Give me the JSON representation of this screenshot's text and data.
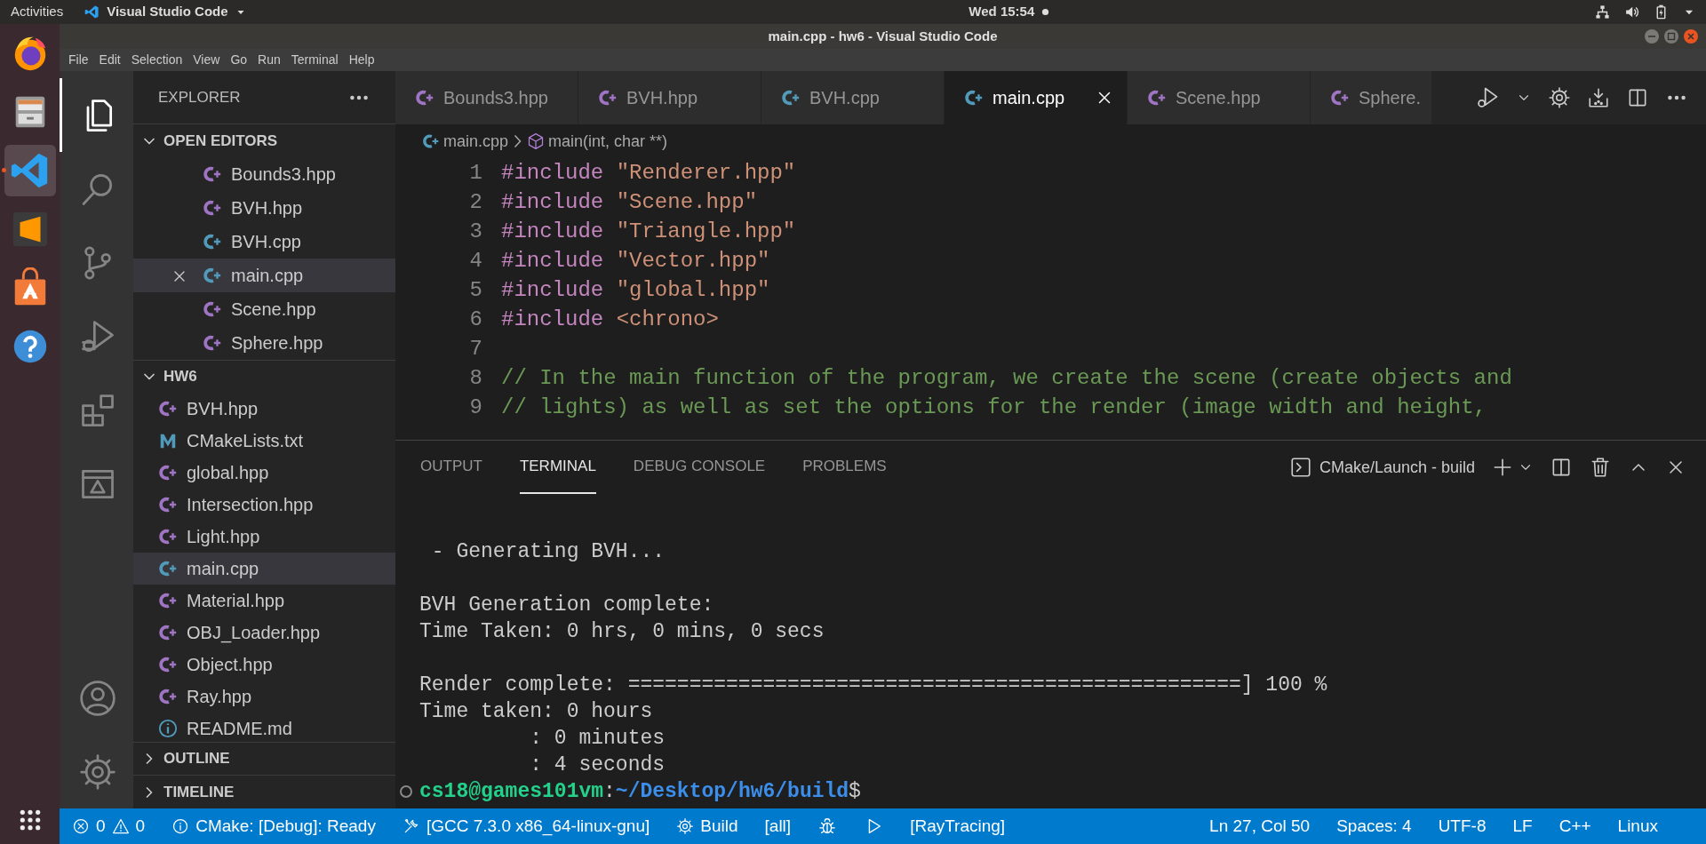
{
  "top_bar": {
    "activities": "Activities",
    "app_name": "Visual Studio Code",
    "clock": "Wed 15:54"
  },
  "window": {
    "title": "main.cpp - hw6 - Visual Studio Code"
  },
  "menu": [
    "File",
    "Edit",
    "Selection",
    "View",
    "Go",
    "Run",
    "Terminal",
    "Help"
  ],
  "dock": [
    {
      "kind": "browser",
      "selected": false
    },
    {
      "kind": "files",
      "selected": false
    },
    {
      "kind": "vscode",
      "selected": true
    },
    {
      "kind": "sublime",
      "selected": false
    },
    {
      "kind": "store",
      "selected": false
    },
    {
      "kind": "help",
      "selected": false
    }
  ],
  "activity_bar": [
    {
      "kind": "explorer",
      "selected": true
    },
    {
      "kind": "search",
      "selected": false
    },
    {
      "kind": "scm",
      "selected": false
    },
    {
      "kind": "debug",
      "selected": false
    },
    {
      "kind": "extensions",
      "selected": false
    },
    {
      "kind": "remote",
      "selected": false
    }
  ],
  "sidebar": {
    "title": "EXPLORER",
    "sections": [
      {
        "title": "OPEN EDITORS",
        "expanded": true,
        "items": [
          {
            "name": "Bounds3.hpp",
            "kind": "hpp",
            "selected": false
          },
          {
            "name": "BVH.hpp",
            "kind": "hpp",
            "selected": false
          },
          {
            "name": "BVH.cpp",
            "kind": "cpp",
            "selected": false
          },
          {
            "name": "main.cpp",
            "kind": "cpp",
            "selected": true
          },
          {
            "name": "Scene.hpp",
            "kind": "hpp",
            "selected": false
          },
          {
            "name": "Sphere.hpp",
            "kind": "hpp",
            "selected": false
          }
        ]
      },
      {
        "title": "HW6",
        "expanded": true,
        "items": [
          {
            "name": "BVH.hpp",
            "kind": "hpp",
            "selected": false
          },
          {
            "name": "CMakeLists.txt",
            "kind": "cmake",
            "selected": false
          },
          {
            "name": "global.hpp",
            "kind": "hpp",
            "selected": false
          },
          {
            "name": "Intersection.hpp",
            "kind": "hpp",
            "selected": false
          },
          {
            "name": "Light.hpp",
            "kind": "hpp",
            "selected": false
          },
          {
            "name": "main.cpp",
            "kind": "cpp",
            "selected": true
          },
          {
            "name": "Material.hpp",
            "kind": "hpp",
            "selected": false
          },
          {
            "name": "OBJ_Loader.hpp",
            "kind": "hpp",
            "selected": false
          },
          {
            "name": "Object.hpp",
            "kind": "hpp",
            "selected": false
          },
          {
            "name": "Ray.hpp",
            "kind": "hpp",
            "selected": false
          },
          {
            "name": "README.md",
            "kind": "info",
            "selected": false
          }
        ]
      },
      {
        "title": "OUTLINE",
        "expanded": false
      },
      {
        "title": "TIMELINE",
        "expanded": false
      }
    ]
  },
  "tabs": [
    {
      "label": "Bounds3.hpp",
      "kind": "hpp",
      "selected": false
    },
    {
      "label": "BVH.hpp",
      "kind": "hpp",
      "selected": false
    },
    {
      "label": "BVH.cpp",
      "kind": "cpp",
      "selected": false
    },
    {
      "label": "main.cpp",
      "kind": "cpp",
      "selected": true
    },
    {
      "label": "Scene.hpp",
      "kind": "hpp",
      "selected": false
    },
    {
      "label": "Sphere.",
      "kind": "hpp",
      "selected": false
    }
  ],
  "breadcrumb": [
    {
      "text": "main.cpp",
      "kind": "cpp"
    },
    {
      "text": "main(int, char **)",
      "kind": "symbol"
    }
  ],
  "code": [
    {
      "number": "1",
      "segments": [
        {
          "kind": "directive",
          "text": "#include "
        },
        {
          "kind": "string",
          "text": "\"Renderer.hpp\""
        }
      ]
    },
    {
      "number": "2",
      "segments": [
        {
          "kind": "directive",
          "text": "#include "
        },
        {
          "kind": "string",
          "text": "\"Scene.hpp\""
        }
      ]
    },
    {
      "number": "3",
      "segments": [
        {
          "kind": "directive",
          "text": "#include "
        },
        {
          "kind": "string",
          "text": "\"Triangle.hpp\""
        }
      ]
    },
    {
      "number": "4",
      "segments": [
        {
          "kind": "directive",
          "text": "#include "
        },
        {
          "kind": "string",
          "text": "\"Vector.hpp\""
        }
      ]
    },
    {
      "number": "5",
      "segments": [
        {
          "kind": "directive",
          "text": "#include "
        },
        {
          "kind": "string",
          "text": "\"global.hpp\""
        }
      ]
    },
    {
      "number": "6",
      "segments": [
        {
          "kind": "directive",
          "text": "#include "
        },
        {
          "kind": "string",
          "text": "<chrono>"
        }
      ]
    },
    {
      "number": "7"
    },
    {
      "number": "8",
      "segments": [
        {
          "kind": "comment",
          "text": "// In the main function of the program, we create the scene (create objects and"
        }
      ]
    },
    {
      "number": "9",
      "segments": [
        {
          "kind": "comment",
          "text": "// lights) as well as set the options for the render (image width and height,"
        }
      ]
    }
  ],
  "panel": {
    "tabs": [
      {
        "label": "OUTPUT",
        "selected": false
      },
      {
        "label": "TERMINAL",
        "selected": true
      },
      {
        "label": "DEBUG CONSOLE",
        "selected": false
      },
      {
        "label": "PROBLEMS",
        "selected": false
      }
    ],
    "terminal_name": "CMake/Launch - build",
    "blocks": [
      [
        " - Generating BVH..."
      ],
      [
        "BVH Generation complete:",
        "Time Taken: 0 hrs, 0 mins, 0 secs"
      ],
      [
        "Render complete: ==================================================] 100 %",
        "Time taken: 0 hours",
        "         : 0 minutes",
        "         : 4 seconds"
      ]
    ],
    "prompt": [
      {
        "kind": "user",
        "text": "cs18@games101vm"
      },
      {
        "kind": "plain",
        "text": ":"
      },
      {
        "kind": "path",
        "text": "~/Desktop/hw6/build"
      },
      {
        "kind": "plain",
        "text": "$"
      }
    ]
  },
  "status_bar": {
    "left": [
      {
        "kind": "errors",
        "text": "0"
      },
      {
        "kind": "warnings",
        "text": "0"
      },
      {
        "kind": "cmake",
        "text": "CMake: [Debug]: Ready"
      },
      {
        "kind": "kit",
        "text": "[GCC 7.3.0 x86_64-linux-gnu]"
      },
      {
        "kind": "build",
        "text": "Build"
      },
      {
        "kind": "plain",
        "text": "[all]"
      },
      {
        "kind": "debug"
      },
      {
        "kind": "launch"
      },
      {
        "kind": "plain",
        "text": "[RayTracing]"
      }
    ],
    "right": [
      "Ln 27, Col 50",
      "Spaces: 4",
      "UTF-8",
      "LF",
      "C++",
      "Linux"
    ]
  }
}
